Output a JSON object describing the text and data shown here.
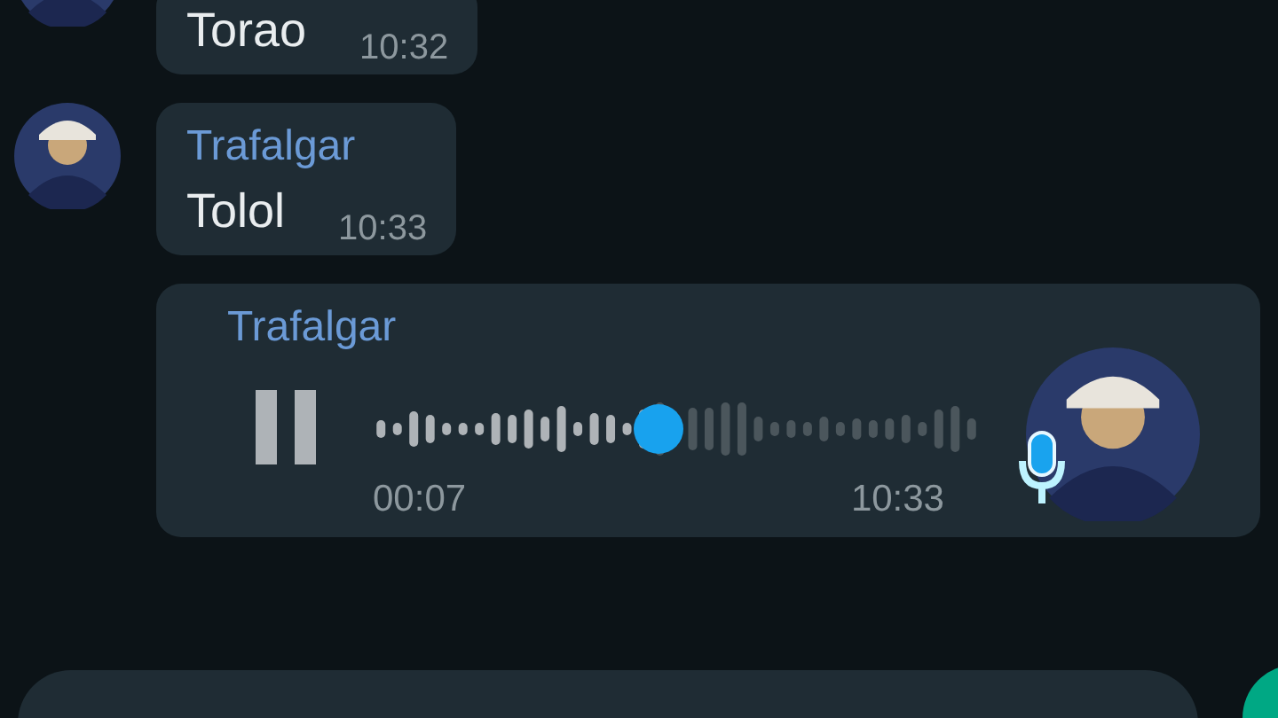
{
  "messages": [
    {
      "kind": "text",
      "text": "Torao",
      "time": "10:32"
    },
    {
      "kind": "text",
      "sender": "Trafalgar",
      "text": "Tolol",
      "time": "10:33"
    },
    {
      "kind": "voice",
      "sender": "Trafalgar",
      "duration": "00:07",
      "time": "10:33",
      "playing": true,
      "level": 0.47
    }
  ]
}
